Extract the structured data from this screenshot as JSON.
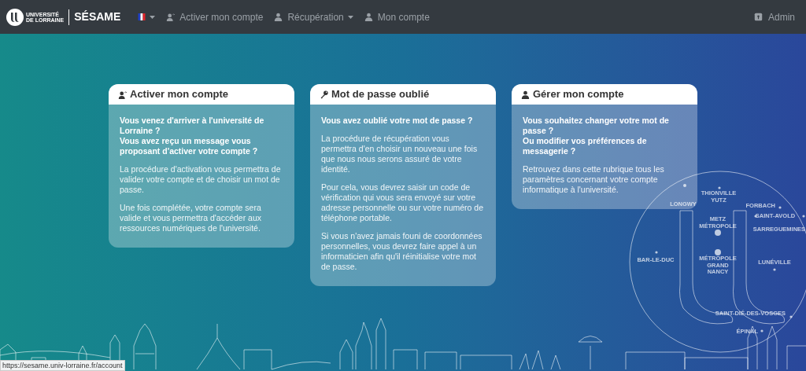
{
  "navbar": {
    "logo_lines": [
      "UNIVERSITÉ",
      "DE LORRAINE"
    ],
    "brand": "SÉSAME",
    "items": [
      {
        "kind": "flag",
        "dropdown": true
      },
      {
        "kind": "link",
        "label": "Activer mon compte",
        "dropdown": false
      },
      {
        "kind": "link",
        "label": "Récupération",
        "dropdown": true
      },
      {
        "kind": "link",
        "label": "Mon compte",
        "dropdown": false
      }
    ],
    "admin": {
      "label": "Admin"
    }
  },
  "cards": [
    {
      "title": "Activer mon compte",
      "questions": [
        "Vous venez d'arriver à l'université de Lorraine ?",
        "Vous avez reçu un message vous proposant d'activer votre compte ?"
      ],
      "paragraphs": [
        "La procédure d'activation vous permettra de valider votre compte et de choisir un mot de passe.",
        "Une fois complétée, votre compte sera valide et vous permettra d'accéder aux ressources numériques de l'université."
      ]
    },
    {
      "title": "Mot de passe oublié",
      "questions": [
        "Vous avez oublié votre mot de passe ?"
      ],
      "paragraphs": [
        "La procédure de récupération vous permettra d'en choisir un nouveau une fois que nous nous serons assuré de votre identité.",
        "Pour cela, vous devrez saisir un code de vérification qui vous sera envoyé sur votre adresse personnelle ou sur votre numéro de téléphone portable.",
        "Si vous n'avez jamais founi de coordonnées personnelles, vous devrez faire appel à un informaticien afin qu'il réinitialise votre mot de passe."
      ]
    },
    {
      "title": "Gérer mon compte",
      "questions": [
        "Vous souhaitez changer votre mot de passe ?",
        "Ou modifier vos préférences de messagerie ?"
      ],
      "paragraphs": [
        "Retrouvez dans cette rubrique tous les paramètres concernant votre compte informatique à l'université."
      ]
    }
  ],
  "map_labels": [
    [
      "LONGWY"
    ],
    [
      "THIONVILLE",
      "YUTZ"
    ],
    [
      "FORBACH"
    ],
    [
      "METZ",
      "MÉTROPOLE"
    ],
    [
      "SAINT-AVOLD"
    ],
    [
      "SARREGUEMINES"
    ],
    [
      "BAR-LE-DUC"
    ],
    [
      "MÉTROPOLE",
      "GRAND",
      "NANCY"
    ],
    [
      "LUNÉVILLE"
    ],
    [
      "SAINT-DIÉ-DES-VOSGES"
    ],
    [
      "ÉPINAL"
    ]
  ],
  "status_url": "https://sesame.univ-lorraine.fr/account"
}
